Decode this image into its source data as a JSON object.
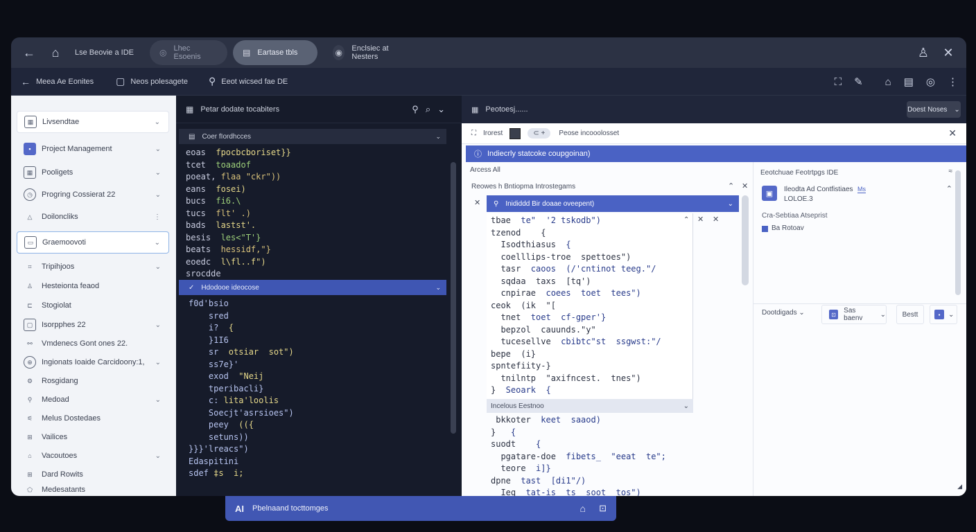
{
  "titlebar": {
    "title": "Lse Beovie a IDE",
    "tabs": [
      {
        "label": "Lhec Esoenis"
      },
      {
        "label": "Eartase tbls"
      },
      {
        "label": "Enclsiec at Nesters"
      }
    ]
  },
  "toolbar": {
    "items": [
      {
        "label": "Meea Ae Eonites"
      },
      {
        "label": "Neos polesagete"
      },
      {
        "label": "Eeot wicsed fae DE"
      }
    ]
  },
  "sidebar": {
    "items": [
      {
        "label": "Livsendtae"
      },
      {
        "label": "Project Management"
      },
      {
        "label": "Pooligets"
      },
      {
        "label": "Progring Cossierat 22"
      },
      {
        "label": "Doiloncliks"
      },
      {
        "label": "Graemoovoti"
      },
      {
        "label": "Tripihjoos"
      },
      {
        "label": "Hesteionta feaod"
      },
      {
        "label": "Stogiolat"
      },
      {
        "label": "Isorpphes 22"
      },
      {
        "label": "Vmdenecs Gont ones 22."
      },
      {
        "label": "Ingionats Ioaide Carcidoony:1,"
      },
      {
        "label": "Rosgidang"
      },
      {
        "label": "Medoad"
      },
      {
        "label": "Melus Dostedaes"
      },
      {
        "label": "Vailices"
      },
      {
        "label": "Vacoutoes"
      },
      {
        "label": "Dard Rowits"
      },
      {
        "label": "Medesatants"
      }
    ]
  },
  "code_panel": {
    "header": "Petar dodate tocabiters",
    "section1": "Coer fIordhcces",
    "section2": "Hdodooe ideocose",
    "lines_top": [
      "eoas  fpocbcboriset}}",
      "tcet  toaadof",
      "poeat, flaa \"ckr\"))",
      "eans  fosei)",
      "bucs  fi6.\\",
      "tucs  flt' .)",
      "bads  lastst'.",
      "besis  les<\"T'}",
      "beats  hessidf,\"}",
      "eoedc  l\\fl..f\")",
      "srocdde"
    ],
    "lines_bottom": [
      "f0d'bsio",
      "    sred",
      "    i?  {",
      "    }1I6",
      "    sr  otsiar  sot\")",
      "    ss7e}'",
      "    exod  \"Neij",
      "    tperibacli}",
      "    c: lita'loolis",
      "    Soecjt'asrsioes\")",
      "    peey  (({",
      "    setuns))",
      "}}}'lreacs\")",
      "Edaspitini",
      "sdef ‡s  i;"
    ]
  },
  "right_panel": {
    "top_label": "Peotoesj......",
    "button": "Doest Noses",
    "doc_title": "Peose incooolosset",
    "banner": "Indiecrly statcoke coupgoinan)",
    "filter_label": "Arcess  All",
    "sub_title": "Reowes h Bntiopma Introstegams",
    "inner_banner": "Inididdd Bir doaae oveepent)",
    "code": [
      "tbae  te\"  '2 tskodb\")",
      "tzenod    {",
      "  Isodthiasus  {",
      "  coelllips-troe  spettoes\")",
      "  tasr  caoos  (/'cntinot teeg.\"/",
      "  sqdaa  taxs  [tq')",
      "  cnpirae  coees  toet  tees\")",
      "ceok  (ik  \"[",
      "  tnet  toet  cf-gper'}",
      "  bepzol  cauunds.\"y\"",
      "  tucesellve  cbibtc\"st  ssgwst:\"/",
      "bepe  (i}",
      "spntefiity-}",
      "  tnilntp  \"axifncest.  tnes\")",
      "}  Seoark  {"
    ],
    "section": "Incelous Eestnoo",
    "code2": [
      " bkkoter  keet  saaod)",
      "}   {",
      "suodt    {",
      "  pgatare-doe  fibets_  \"eeat  te\";",
      "  teore  i]}",
      "dpne  tast  [di1\"/)",
      "  Ieq  tat-is  ts  soot  tos\")"
    ],
    "aside_title": "Eeotchuae Feotrtpgs IDE",
    "aside_item": "Ileodta Ad Contfistiaes",
    "aside_badge": "Ms",
    "aside_item_sub": "LOLOE.3",
    "aside_label": "Cra-Sebtiaa Atseprist",
    "aside_checkbox": "Ba Rotoav",
    "aside_controls": [
      "Dootdigads",
      "Sas baenv",
      "Bestt"
    ]
  },
  "statusbar": {
    "label": "Pbelnaand tocttomges"
  },
  "colors": {
    "accent": "#4157b3",
    "banner": "#4a62c4",
    "bg": "#0b0d15",
    "sidebar": "#f2f4f8",
    "editor": "#161b2a"
  }
}
